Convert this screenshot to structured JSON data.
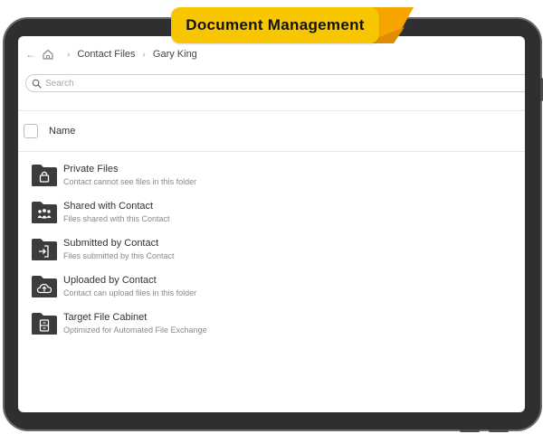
{
  "banner": {
    "title": "Document Management"
  },
  "breadcrumb": {
    "back_icon": "back-arrow-icon",
    "home_icon": "home-icon",
    "items": [
      "Contact Files",
      "Gary King"
    ]
  },
  "search": {
    "placeholder": "Search",
    "value": ""
  },
  "table": {
    "header_name": "Name"
  },
  "folders": [
    {
      "title": "Private Files",
      "subtitle": "Contact cannot see files in this folder",
      "icon": "lock-icon"
    },
    {
      "title": "Shared with Contact",
      "subtitle": "Files shared with this Contact",
      "icon": "people-icon"
    },
    {
      "title": "Submitted by Contact",
      "subtitle": "Files submitted by this Contact",
      "icon": "submit-icon"
    },
    {
      "title": "Uploaded by Contact",
      "subtitle": "Contact can upload files in this folder",
      "icon": "cloud-upload-icon"
    },
    {
      "title": "Target File Cabinet",
      "subtitle": "Optimized for Automated File Exchange",
      "icon": "file-cabinet-icon"
    }
  ],
  "colors": {
    "banner": "#f7c600",
    "bezel": "#2f2f31",
    "folder": "#3c3c3e"
  }
}
